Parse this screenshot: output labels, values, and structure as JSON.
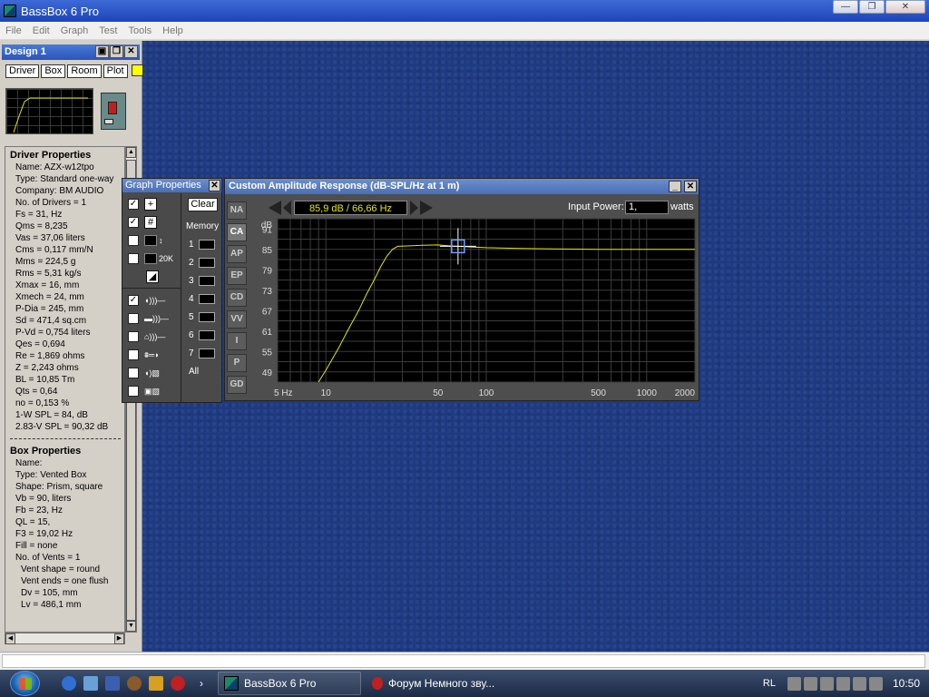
{
  "window": {
    "title": "BassBox 6 Pro",
    "controls": {
      "minimize": "—",
      "maximize": "❐",
      "close": "✕"
    }
  },
  "menu": [
    "File",
    "Edit",
    "Graph",
    "Test",
    "Tools",
    "Help"
  ],
  "design_panel": {
    "title": "Design 1",
    "tabs": [
      "Driver",
      "Box",
      "Room",
      "Plot"
    ],
    "swatch_color": "#ffff00",
    "driver_properties": {
      "heading": "Driver Properties",
      "rows": [
        "Name: AZX-w12tpo",
        "Type: Standard one-way",
        "Company: BM AUDIO",
        "No. of Drivers = 1",
        "Fs = 31, Hz",
        "Qms = 8,235",
        "Vas = 37,06 liters",
        "Cms = 0,117 mm/N",
        "Mms = 224,5 g",
        "Rms = 5,31 kg/s",
        "Xmax = 16, mm",
        "Xmech = 24, mm",
        "P-Dia = 245, mm",
        "Sd = 471,4 sq.cm",
        "P-Vd = 0,754 liters",
        "Qes = 0,694",
        "Re = 1,869 ohms",
        "Z = 2,243 ohms",
        "BL = 10,85 Tm",
        "Qts = 0,64",
        "no = 0,153 %",
        "1-W SPL = 84, dB",
        "2.83-V SPL = 90,32 dB"
      ]
    },
    "box_properties": {
      "heading": "Box Properties",
      "rows": [
        {
          "text": "Name:",
          "indent": false
        },
        {
          "text": "Type: Vented Box",
          "indent": false
        },
        {
          "text": "Shape: Prism, square",
          "indent": false
        },
        {
          "text": "Vb = 90, liters",
          "indent": false
        },
        {
          "text": "Fb = 23, Hz",
          "indent": false
        },
        {
          "text": "QL = 15,",
          "indent": false
        },
        {
          "text": "F3 = 19,02 Hz",
          "indent": false
        },
        {
          "text": "Fill = none",
          "indent": false
        },
        {
          "text": "No. of Vents = 1",
          "indent": false
        },
        {
          "text": "Vent shape = round",
          "indent": true
        },
        {
          "text": "Vent ends = one flush",
          "indent": true
        },
        {
          "text": "Dv = 105, mm",
          "indent": true
        },
        {
          "text": "Lv = 486,1 mm",
          "indent": true
        }
      ]
    }
  },
  "graph_properties": {
    "title": "Graph Properties",
    "close": "✕",
    "clear_label": "Clear",
    "memory_label": "Memory",
    "memory_slots": [
      "1",
      "2",
      "3",
      "4",
      "5",
      "6",
      "7"
    ],
    "all_label": "All",
    "range_label": "20K",
    "checkboxes": [
      true,
      true,
      false,
      false,
      true,
      false,
      false,
      false,
      false,
      false
    ]
  },
  "amplitude_window": {
    "title": "Custom Amplitude Response (dB-SPL/Hz at 1 m)",
    "minimize": "_",
    "close": "✕",
    "side_tabs": [
      "NA",
      "CA",
      "AP",
      "EP",
      "CD",
      "VV",
      "I",
      "P",
      "GD"
    ],
    "active_tab": "CA",
    "readout": "85,9 dB / 66,66 Hz",
    "input_power_label": "Input Power:",
    "input_power_value": "1,",
    "watts_label": "watts"
  },
  "chart_data": {
    "type": "line",
    "title": "Custom Amplitude Response (dB-SPL/Hz at 1 m)",
    "ylabel": "dB",
    "xlabel": "",
    "x_scale": "log",
    "xlim": [
      5,
      2000
    ],
    "ylim": [
      46,
      94
    ],
    "y_ticks": [
      91,
      85,
      79,
      73,
      67,
      61,
      55,
      49
    ],
    "x_tick_labels": [
      {
        "value": 5,
        "label": "5 Hz"
      },
      {
        "value": 10,
        "label": "10"
      },
      {
        "value": 50,
        "label": "50"
      },
      {
        "value": 100,
        "label": "100"
      },
      {
        "value": 500,
        "label": "500"
      },
      {
        "value": 1000,
        "label": "1000"
      },
      {
        "value": 2000,
        "label": "2000"
      }
    ],
    "grid": true,
    "cursor": {
      "x": 66.66,
      "y": 85.9
    },
    "series": [
      {
        "color": "#e6e600",
        "points": [
          [
            9,
            46
          ],
          [
            10,
            49.5
          ],
          [
            12,
            56
          ],
          [
            14,
            62
          ],
          [
            16,
            67
          ],
          [
            18,
            72
          ],
          [
            20,
            76
          ],
          [
            22,
            80
          ],
          [
            24,
            83
          ],
          [
            26,
            85
          ],
          [
            28,
            85.9
          ],
          [
            32,
            86
          ],
          [
            40,
            86.2
          ],
          [
            50,
            86.3
          ],
          [
            60,
            86
          ],
          [
            66.66,
            85.9
          ],
          [
            80,
            85.7
          ],
          [
            100,
            85.5
          ],
          [
            150,
            85.3
          ],
          [
            200,
            85.2
          ],
          [
            300,
            85.1
          ],
          [
            500,
            85.0
          ],
          [
            1000,
            85.0
          ],
          [
            2000,
            85.0
          ]
        ]
      }
    ]
  },
  "taskbar": {
    "apps": [
      {
        "label": "BassBox 6 Pro",
        "active": true
      },
      {
        "label": "Форум Немного зву...",
        "active": false
      }
    ],
    "expand": "›",
    "language": "RL",
    "clock": "10:50"
  }
}
